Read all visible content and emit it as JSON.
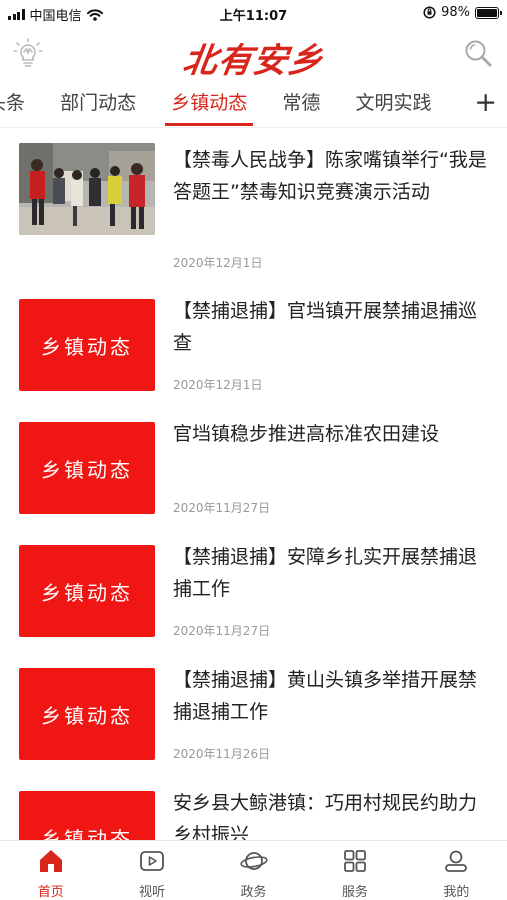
{
  "status_bar": {
    "carrier": "中国电信",
    "time": "上午11:07",
    "battery": "98%",
    "battery_level": 0.98
  },
  "header": {
    "logo_text": "北有安乡",
    "left_icon": "lightbulb-icon",
    "right_icon": "search-icon"
  },
  "tabs": {
    "items": [
      {
        "label": "头条"
      },
      {
        "label": "部门动态"
      },
      {
        "label": "乡镇动态"
      },
      {
        "label": "常德"
      },
      {
        "label": "文明实践"
      }
    ],
    "active_index": 2,
    "add_label": "+"
  },
  "news": [
    {
      "title": "【禁毒人民战争】陈家嘴镇举行“我是答题王”禁毒知识竞赛演示活动",
      "date": "2020年12月1日",
      "thumb_type": "photo"
    },
    {
      "title": "【禁捕退捕】官垱镇开展禁捕退捕巡查",
      "date": "2020年12月1日",
      "thumb_type": "label",
      "thumb_text": "乡镇动态"
    },
    {
      "title": "官垱镇稳步推进高标准农田建设",
      "date": "2020年11月27日",
      "thumb_type": "label",
      "thumb_text": "乡镇动态"
    },
    {
      "title": "【禁捕退捕】安障乡扎实开展禁捕退捕工作",
      "date": "2020年11月27日",
      "thumb_type": "label",
      "thumb_text": "乡镇动态"
    },
    {
      "title": "【禁捕退捕】黄山头镇多举措开展禁捕退捕工作",
      "date": "2020年11月26日",
      "thumb_type": "label",
      "thumb_text": "乡镇动态"
    },
    {
      "title": "安乡县大鲸港镇：巧用村规民约助力乡村振兴",
      "date": "",
      "thumb_type": "label",
      "thumb_text": "乡镇动态"
    }
  ],
  "bottom_nav": {
    "items": [
      {
        "label": "首页",
        "icon": "home-icon",
        "active": true
      },
      {
        "label": "视听",
        "icon": "play-icon",
        "active": false
      },
      {
        "label": "政务",
        "icon": "planet-icon",
        "active": false
      },
      {
        "label": "服务",
        "icon": "grid-icon",
        "active": false
      },
      {
        "label": "我的",
        "icon": "user-icon",
        "active": false
      }
    ]
  },
  "colors": {
    "brand_red": "#d9261c",
    "thumb_red": "#f01614",
    "date_gray": "#999999"
  }
}
